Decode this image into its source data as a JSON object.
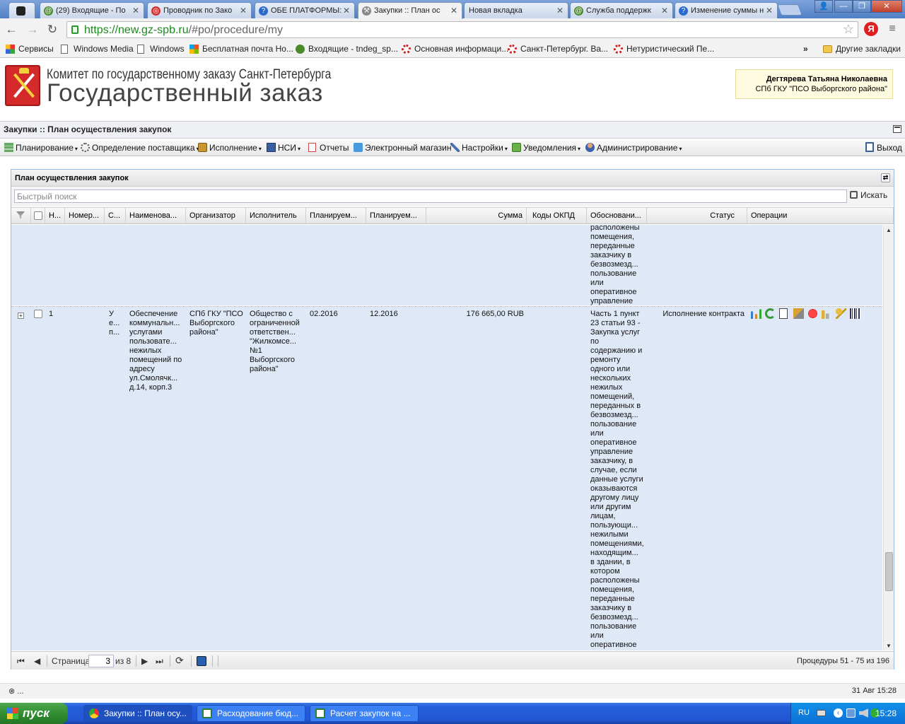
{
  "browser": {
    "tabs": [
      {
        "label": "(29) Входящие - По",
        "icon_color": "#4a8a2a"
      },
      {
        "label": "Проводник по Зако",
        "icon_color": "#d03030"
      },
      {
        "label": "ОБЕ ПЛАТФОРМЫ:",
        "icon_color": "#2a6ad0"
      },
      {
        "label": "Закупки :: План ос",
        "icon_color": "#666666"
      },
      {
        "label": "Новая вкладка",
        "icon_color": ""
      },
      {
        "label": "Служба поддержк",
        "icon_color": "#4a8a2a"
      },
      {
        "label": "Изменение суммы н",
        "icon_color": "#2a6ad0"
      }
    ],
    "url_scheme_host": "https://new.gz-spb.ru",
    "url_path": "/#po/procedure/my",
    "yandex_label": "Я",
    "bookmarks": [
      {
        "label": "Сервисы",
        "icon": "apps-icon"
      },
      {
        "label": "Windows Media",
        "icon": "page-icon"
      },
      {
        "label": "Windows",
        "icon": "page-icon"
      },
      {
        "label": "Бесплатная почта Ho...",
        "icon": "windows-logo-icon"
      },
      {
        "label": "Входящие - tndeg_sp...",
        "icon": "mail-icon"
      },
      {
        "label": "Основная информаци...",
        "icon": "gear-icon"
      },
      {
        "label": "Санкт-Петербург. Ва...",
        "icon": "gear-icon"
      },
      {
        "label": "Нетуристический Пе...",
        "icon": "gear-icon"
      }
    ],
    "more_bookmarks": "»",
    "other_bookmarks": "Другие закладки"
  },
  "site": {
    "title_line1": "Комитет по государственному заказу Санкт-Петербурга",
    "title_line2": "Государственный заказ",
    "user_name": "Дегтярева Татьяна Николаевна",
    "user_org": "СПб ГКУ \"ПСО Выборгского района\""
  },
  "app": {
    "title": "Закупки :: План осуществления закупок",
    "menu": [
      {
        "label": "Планирование",
        "dropdown": true
      },
      {
        "label": "Определение поставщика",
        "dropdown": true
      },
      {
        "label": "Исполнение",
        "dropdown": true
      },
      {
        "label": "НСИ",
        "dropdown": true
      },
      {
        "label": "Отчеты",
        "dropdown": false
      },
      {
        "label": "Электронный магазин",
        "dropdown": false
      },
      {
        "label": "Настройки",
        "dropdown": true
      },
      {
        "label": "Уведомления",
        "dropdown": true
      },
      {
        "label": "Администрирование",
        "dropdown": true
      }
    ],
    "dropdown_arrow": "▾",
    "exit_label": "Выход"
  },
  "panel": {
    "title": "План осуществления закупок",
    "search_placeholder": "Быстрый поиск",
    "search_button": "Искать",
    "columns": [
      "Н...",
      "Номер...",
      "С...",
      "Наименова...",
      "Организатор",
      "Исполнитель",
      "Планируем...",
      "Планируем...",
      "Сумма",
      "Коды ОКПД",
      "Обосновани...",
      "Статус",
      "Операции"
    ],
    "prev_row_tail": "расположены\nпомещения,\nпереданные\nзаказчику в\nбезвозмезд...\nпользование\nили\nоперативное\nуправление",
    "row": {
      "expander": "+",
      "num": "1",
      "status_short": "У\nе...\nп...",
      "name": "Обеспечение\nкоммунальн...\nуслугами\nпользовате...\nнежилых\nпомещений по\nадресу\nул.Смолячк...\nд.14, корп.3",
      "organizer": "СПб ГКУ \"ПСО\nВыборгского\nрайона\"",
      "executor": "Общество с\nограниченной\nответствен...\n\"Жилкомсе...\n№1\nВыборгского\nрайона\"",
      "planned_start": "02.2016",
      "planned_end": "12.2016",
      "sum": "176 665,00 RUB",
      "okpd": "",
      "justification": "Часть 1 пункт\n23 статьи 93 -\nЗакупка услуг\nпо\nсодержанию и\nремонту\nодного или\nнескольких\nнежилых\nпомещений,\nпереданных в\nбезвозмезд...\nпользование\nили\nоперативное\nуправление\nзаказчику, в\nслучае, если\nданные услуги\nоказываются\nдругому лицу\nили другим\nлицам,\nпользующи...\nнежилыми\nпомещениями,\nнаходящим...\nв здании, в\nкотором\nрасположены\nпомещения,\nпереданные\nзаказчику в\nбезвозмезд...\nпользование\nили\nоперативное\nуправление",
      "status": "Исполнение контракта",
      "operations": [
        "chart-icon",
        "cycle-icon",
        "document-icon",
        "edit-icon",
        "stop-icon",
        "report-icon",
        "key-icon",
        "barcode-icon"
      ]
    },
    "pager": {
      "page_label": "Страница",
      "page_value": "3",
      "of_label": "из 8",
      "info": "Процедуры 51 - 75 из 196"
    }
  },
  "statusbar": {
    "left": "⊗ ...",
    "right": "31 Авг 15:28"
  },
  "taskbar": {
    "start": "пуск",
    "items": [
      {
        "label": "Закупки :: План осу...",
        "active": true
      },
      {
        "label": "Расходование бюд...",
        "active": false
      },
      {
        "label": "Расчет закупок на ...",
        "active": false
      }
    ],
    "lang": "RU",
    "clock": "15:28"
  }
}
